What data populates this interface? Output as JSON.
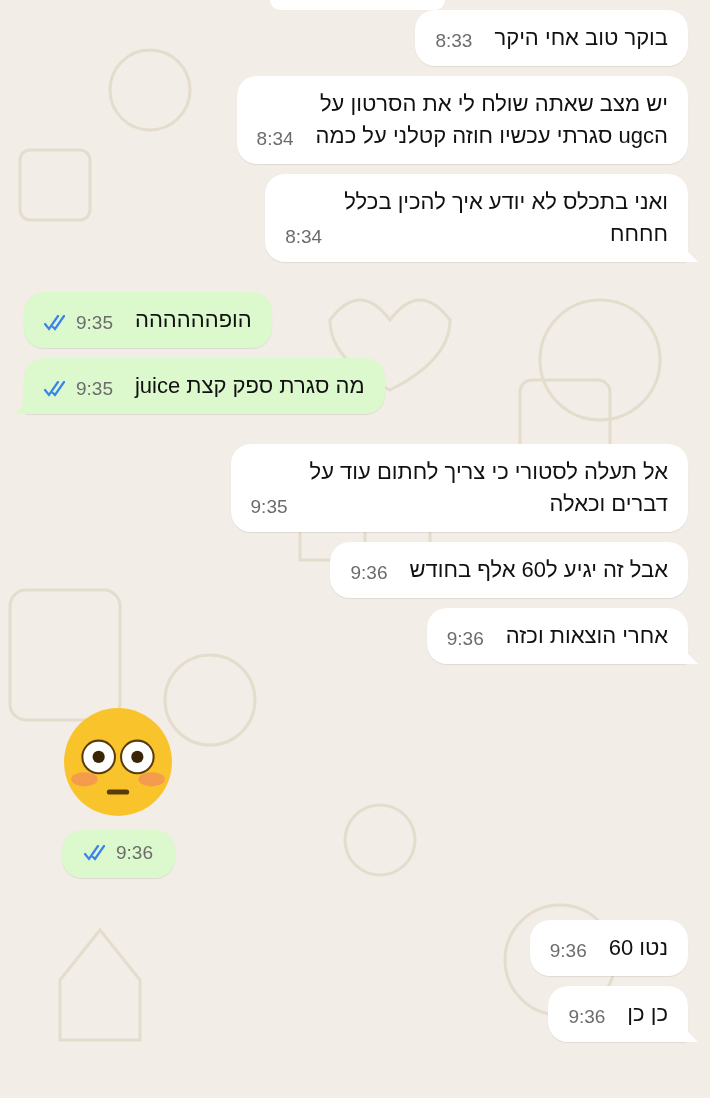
{
  "messages": [
    {
      "kind": "partial",
      "sent": false
    },
    {
      "kind": "text",
      "sent": false,
      "text": "בוקר טוב אחי היקר",
      "time": "8:33",
      "tail": false
    },
    {
      "kind": "text",
      "sent": false,
      "text": "יש מצב שאתה שולח לי את הסרטון על\nהugc סגרתי עכשיו חוזה קטלני על כמה",
      "time": "8:34",
      "tail": false
    },
    {
      "kind": "text",
      "sent": false,
      "text": "ואני בתכלס לא יודע איך להכין בכלל\nחחחח",
      "time": "8:34",
      "tail": true
    },
    {
      "kind": "text",
      "sent": true,
      "text": "הופהההההה",
      "time": "9:35",
      "read": true,
      "tail": false
    },
    {
      "kind": "text",
      "sent": true,
      "text": "מה סגרת ספק קצת juice",
      "time": "9:35",
      "read": true,
      "tail": true
    },
    {
      "kind": "text",
      "sent": false,
      "text": "אל תעלה לסטורי כי צריך לחתום עוד על\nדברים וכאלה",
      "time": "9:35",
      "tail": false
    },
    {
      "kind": "text",
      "sent": false,
      "text": "אבל זה יגיע ל60 אלף בחודש",
      "time": "9:36",
      "tail": false
    },
    {
      "kind": "text",
      "sent": false,
      "text": "אחרי הוצאות וכזה",
      "time": "9:36",
      "tail": true
    },
    {
      "kind": "emoji",
      "sent": true,
      "time": "9:36",
      "read": true,
      "tail": false
    },
    {
      "kind": "text",
      "sent": false,
      "text": "נטו 60",
      "time": "9:36",
      "tail": false
    },
    {
      "kind": "text",
      "sent": false,
      "text": "כן כן",
      "time": "9:36",
      "tail": true
    }
  ]
}
